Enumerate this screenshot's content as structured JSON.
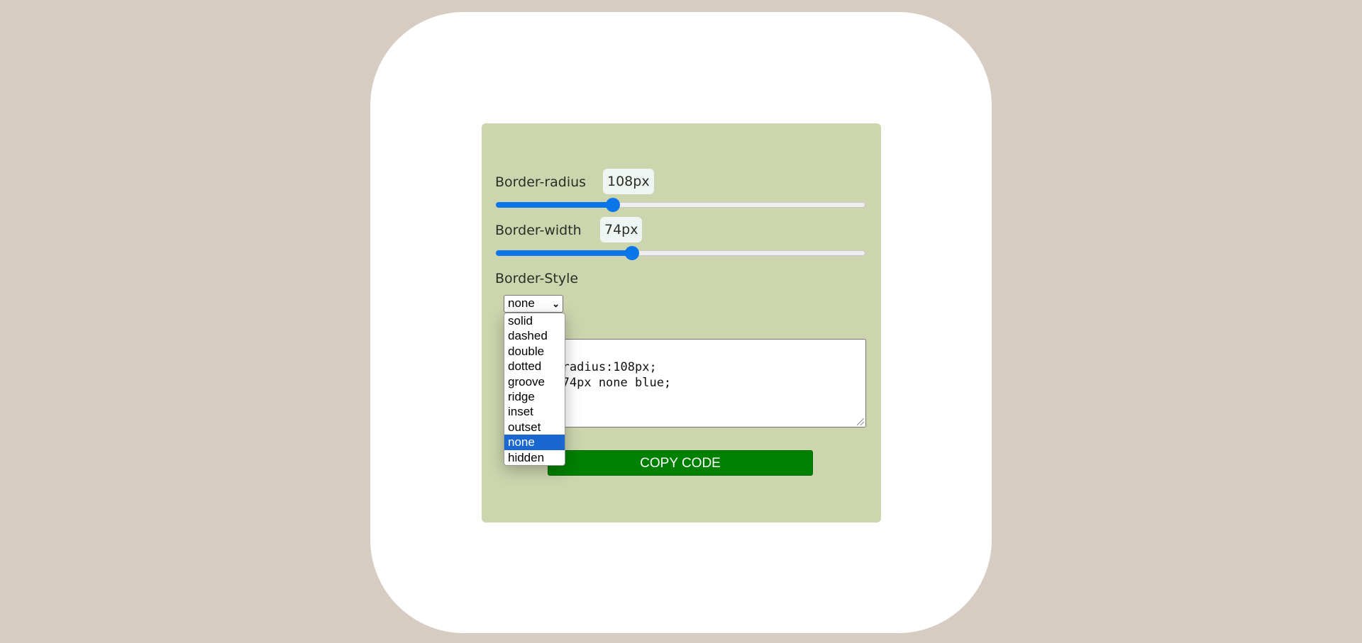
{
  "controls": {
    "border_radius": {
      "label": "Border-radius",
      "value_text": "108px",
      "value": 108,
      "max": 340
    },
    "border_width": {
      "label": "Border-width",
      "value_text": "74px",
      "value": 74,
      "max": 200
    },
    "border_style": {
      "label": "Border-Style",
      "selected": "none",
      "options": [
        "solid",
        "dashed",
        "double",
        "dotted",
        "groove",
        "ridge",
        "inset",
        "outset",
        "none",
        "hidden"
      ]
    }
  },
  "code_output": {
    "line1": "border-radius:108px;",
    "line2": "border:74px none blue;"
  },
  "copy_button": {
    "label": "COPY CODE"
  },
  "colors": {
    "page_background": "#d7ccc2",
    "preview_box": "#ffffff",
    "panel": "#ccd5ae",
    "slider_accent": "#0b76e9",
    "copy_button": "#008000",
    "option_highlight": "#1a67d2"
  }
}
